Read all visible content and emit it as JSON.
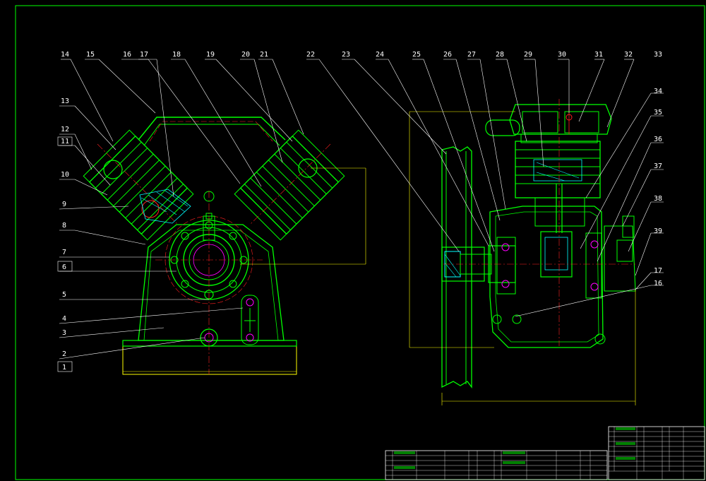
{
  "drawing": {
    "colors": {
      "background": "#000000",
      "outline": "#00ff00",
      "dimension": "#ffff00",
      "leader": "#ffffff",
      "centerline": "#ff2020",
      "hatch": "#00ffff",
      "accent": "#ff00ff"
    },
    "left_view_labels": [
      "14",
      "15",
      "16",
      "17",
      "18",
      "19",
      "20",
      "21",
      "13",
      "12",
      "11",
      "10",
      "9",
      "8",
      "7",
      "6",
      "5",
      "4",
      "3",
      "2",
      "1"
    ],
    "right_view_labels": [
      "22",
      "23",
      "24",
      "25",
      "26",
      "27",
      "28",
      "29",
      "30",
      "31",
      "32",
      "33",
      "34",
      "35",
      "36",
      "37",
      "38",
      "39",
      "17",
      "16"
    ]
  }
}
